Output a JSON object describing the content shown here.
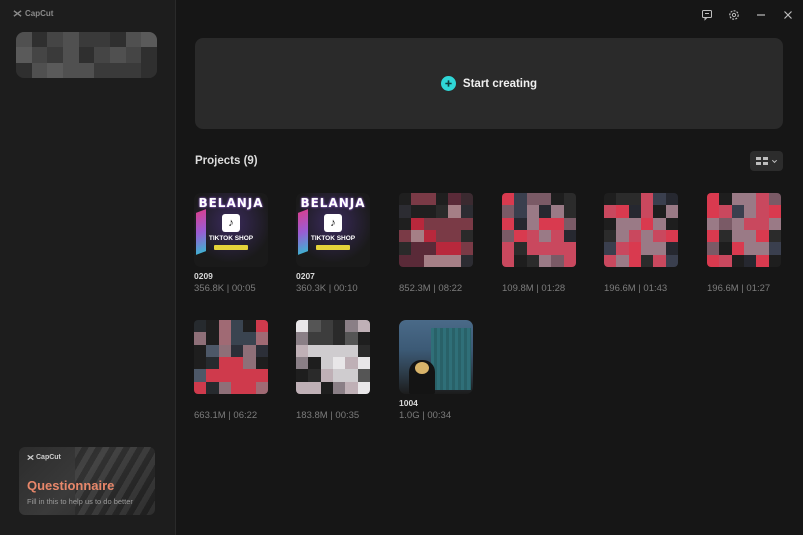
{
  "app": {
    "name": "CapCut"
  },
  "window_controls": [
    {
      "name": "feedback-icon"
    },
    {
      "name": "settings-icon"
    },
    {
      "name": "minimize-icon"
    },
    {
      "name": "close-icon"
    }
  ],
  "start": {
    "label": "Start creating"
  },
  "projects": {
    "header": "Projects  (9)",
    "items": [
      {
        "name": "0209",
        "meta": "356.8K | 00:05"
      },
      {
        "name": "0207",
        "meta": "360.3K | 00:10"
      },
      {
        "name": "",
        "meta": "852.3M | 08:22"
      },
      {
        "name": "",
        "meta": "109.8M | 01:28"
      },
      {
        "name": "",
        "meta": "196.6M | 01:43"
      },
      {
        "name": "",
        "meta": "196.6M | 01:27"
      },
      {
        "name": "",
        "meta": "663.1M | 06:22"
      },
      {
        "name": "",
        "meta": "183.8M | 00:35"
      },
      {
        "name": "1004",
        "meta": "1.0G | 00:34"
      }
    ],
    "thumb_texts": {
      "belanja": "BELANJA",
      "tiktok_shop": "TIKTOK SHOP"
    }
  },
  "questionnaire": {
    "brand": "CapCut",
    "title": "Questionnaire",
    "subtitle": "Fill in this to help us to do better"
  }
}
